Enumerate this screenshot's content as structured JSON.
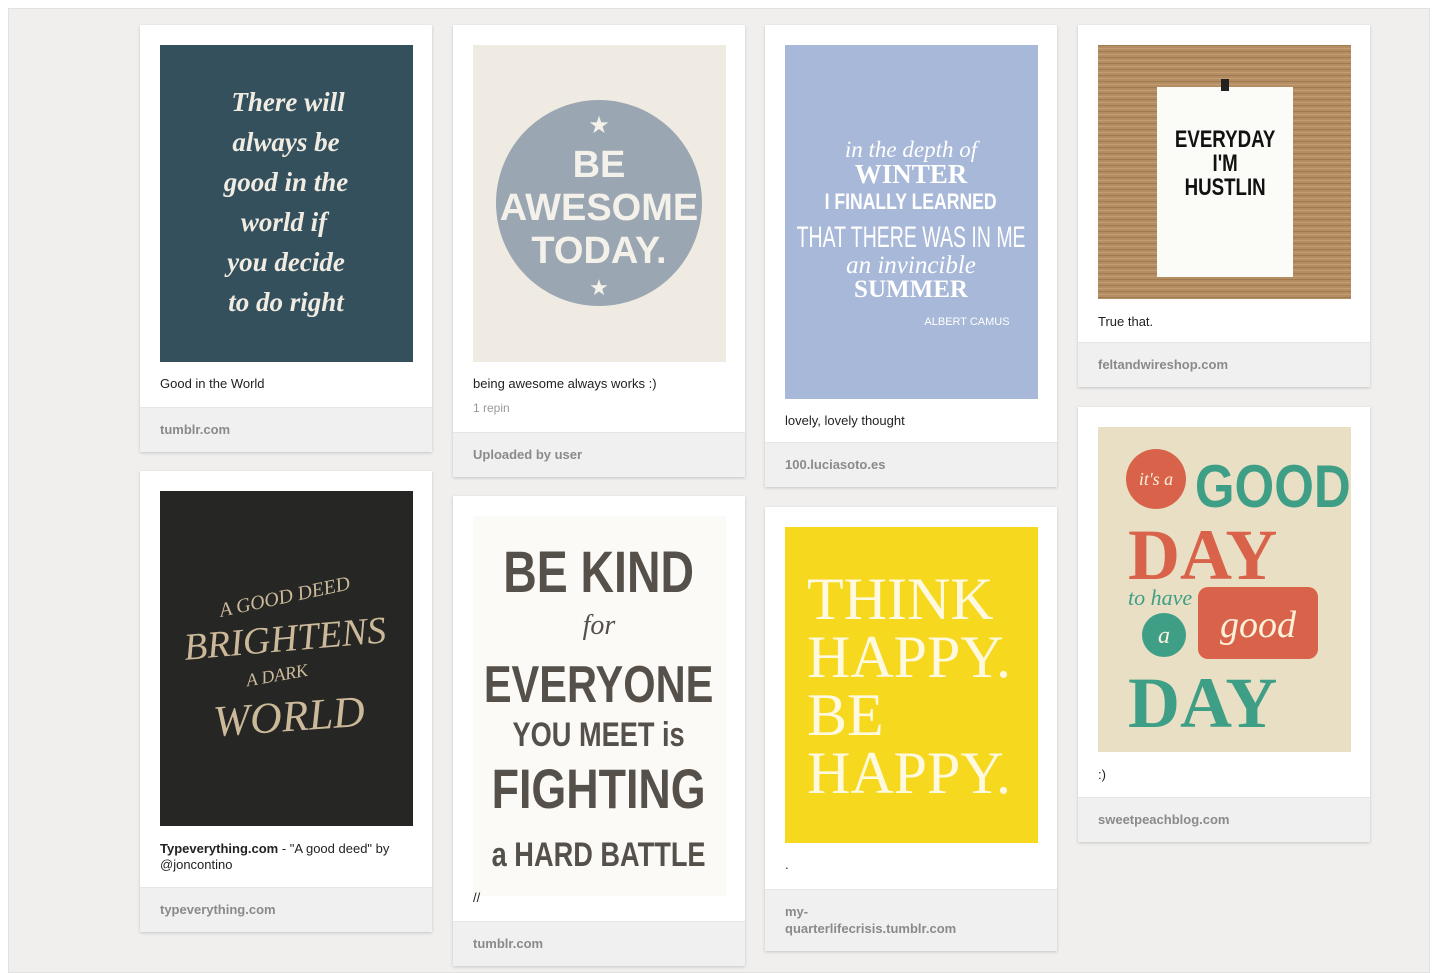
{
  "pins": [
    {
      "id": "good-world",
      "description": "Good in the World",
      "source": "tumblr.com",
      "image_text": [
        "There will",
        "always be",
        "good in the",
        "world if",
        "you decide",
        "to do right"
      ],
      "image_colors": {
        "bg": "#34505d",
        "fg": "#f1ece2"
      }
    },
    {
      "id": "be-awesome",
      "description": "being awesome always works :)",
      "stats": "1 repin",
      "source": "Uploaded by user",
      "image_text": [
        "BE",
        "AWESOME",
        "TODAY."
      ],
      "image_colors": {
        "bg": "#efebe3",
        "circle": "#9aa6b1",
        "fg": "#f4f1ea"
      }
    },
    {
      "id": "winter",
      "description": "lovely, lovely thought",
      "source": "100.luciasoto.es",
      "image_text": [
        "in the depth of",
        "WINTER",
        "I FINALLY LEARNED",
        "THAT THERE WAS IN ME",
        "an invincible",
        "SUMMER",
        "ALBERT CAMUS"
      ],
      "image_colors": {
        "bg": "#a8b8d8",
        "fg": "#ffffff"
      }
    },
    {
      "id": "hustlin",
      "description": "True that.",
      "source": "feltandwireshop.com",
      "image_text": [
        "EVERYDAY",
        "I'M",
        "HUSTLIN"
      ],
      "image_colors": {
        "bg": "#b48e62",
        "paper": "#fbfbf8",
        "fg": "#111111"
      }
    },
    {
      "id": "good-deed",
      "description_title": "Typeverything.com",
      "description": " - \"A good deed\" by @joncontino",
      "source": "typeverything.com",
      "image_text": [
        "A GOOD DEED",
        "BRIGHTENS",
        "A DARK",
        "WORLD"
      ],
      "image_colors": {
        "bg": "#262624",
        "fg": "#cbb99a"
      }
    },
    {
      "id": "be-kind",
      "description": "//",
      "source": "tumblr.com",
      "image_text": [
        "BE KIND",
        "for",
        "EVERYONE",
        "YOU MEET is",
        "FIGHTING",
        "a HARD BATTLE"
      ],
      "image_colors": {
        "bg": "#fbfaf7",
        "fg": "#55504a"
      }
    },
    {
      "id": "think-happy",
      "description": ".",
      "source": "my-quarterlifecrisis.tumblr.com",
      "source_lines": [
        "my-",
        "quarterlifecrisis.tumblr.com"
      ],
      "image_text": [
        "THINK",
        "HAPPY.",
        "BE",
        "HAPPY."
      ],
      "image_colors": {
        "bg": "#f6d81e",
        "fg": "#fff9e0"
      }
    },
    {
      "id": "good-day",
      "description": ":)",
      "source": "sweetpeachblog.com",
      "image_text": [
        "it's a",
        "GOOD",
        "DAY",
        "to have",
        "a",
        "good",
        "DAY"
      ],
      "image_colors": {
        "bg": "#e9dfc4",
        "red": "#d9624a",
        "green": "#3f9f86"
      }
    }
  ]
}
